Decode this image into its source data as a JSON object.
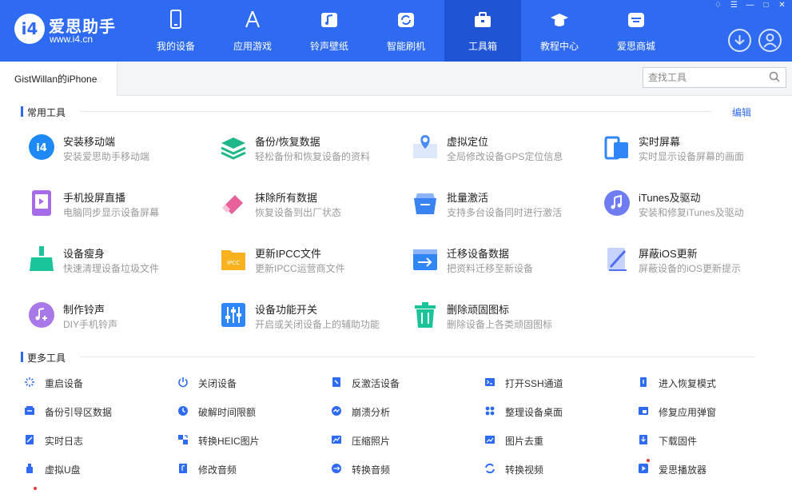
{
  "app": {
    "logo_mark": "i4",
    "logo_name": "爱思助手",
    "logo_url": "www.i4.cn"
  },
  "nav": {
    "items": [
      {
        "label": "我的设备",
        "icon": "phone-icon"
      },
      {
        "label": "应用游戏",
        "icon": "appstore-icon"
      },
      {
        "label": "铃声壁纸",
        "icon": "music-icon"
      },
      {
        "label": "智能刷机",
        "icon": "refresh-icon"
      },
      {
        "label": "工具箱",
        "icon": "toolbox-icon"
      },
      {
        "label": "教程中心",
        "icon": "graduation-cap-icon"
      },
      {
        "label": "爱思商城",
        "icon": "store-icon"
      }
    ],
    "active": "工具箱"
  },
  "device_tab": {
    "label": "GistWillan的iPhone"
  },
  "search": {
    "placeholder": "查找工具"
  },
  "common": {
    "title": "常用工具",
    "edit_label": "编辑",
    "tools": [
      {
        "name": "安装移动端",
        "desc": "安装爱思助手移动端",
        "icon": "i4-app-icon",
        "color": "#1e88f5"
      },
      {
        "name": "备份/恢复数据",
        "desc": "轻松备份和恢复设备的资料",
        "icon": "layers-icon",
        "color": "#1fb88a"
      },
      {
        "name": "虚拟定位",
        "desc": "全局修改设备GPS定位信息",
        "icon": "map-pin-icon",
        "color": "#4a8af4"
      },
      {
        "name": "实时屏幕",
        "desc": "实时显示设备屏幕的画面",
        "icon": "screen-mirror-icon",
        "color": "#2f86f6"
      },
      {
        "name": "手机投屏直播",
        "desc": "电脑同步显示设备屏幕",
        "icon": "cast-live-icon",
        "color": "#a66be8"
      },
      {
        "name": "抹除所有数据",
        "desc": "恢复设备到出厂状态",
        "icon": "eraser-icon",
        "color": "#e8609a"
      },
      {
        "name": "批量激活",
        "desc": "支持多台设备同时进行激活",
        "icon": "batch-activate-icon",
        "color": "#3a82f2"
      },
      {
        "name": "iTunes及驱动",
        "desc": "安装和修复iTunes及驱动",
        "icon": "itunes-icon",
        "color": "#6f7cf2"
      },
      {
        "name": "设备瘦身",
        "desc": "快速清理设备垃圾文件",
        "icon": "broom-icon",
        "color": "#19c49a"
      },
      {
        "name": "更新IPCC文件",
        "desc": "更新IPCC运营商文件",
        "icon": "ipcc-folder-icon",
        "color": "#f7b21d"
      },
      {
        "name": "迁移设备数据",
        "desc": "把资料迁移至新设备",
        "icon": "migrate-icon",
        "color": "#2f86f6"
      },
      {
        "name": "屏蔽iOS更新",
        "desc": "屏蔽设备的iOS更新提示",
        "icon": "block-update-icon",
        "color": "#4f6ff0"
      },
      {
        "name": "制作铃声",
        "desc": "DIY手机铃声",
        "icon": "ringtone-icon",
        "color": "#a877e8"
      },
      {
        "name": "设备功能开关",
        "desc": "开启或关闭设备上的辅助功能",
        "icon": "toggle-sliders-icon",
        "color": "#2f86f6"
      },
      {
        "name": "删除顽固图标",
        "desc": "删除设备上各类顽固图标",
        "icon": "trash-icon",
        "color": "#19c49a"
      }
    ]
  },
  "more": {
    "title": "更多工具",
    "tools": [
      {
        "name": "重启设备",
        "icon": "restart-icon"
      },
      {
        "name": "关闭设备",
        "icon": "power-icon"
      },
      {
        "name": "反激活设备",
        "icon": "deactivate-icon"
      },
      {
        "name": "打开SSH通道",
        "icon": "terminal-icon"
      },
      {
        "name": "进入恢复模式",
        "icon": "recovery-icon"
      },
      {
        "name": "备份引导区数据",
        "icon": "backup-boot-icon"
      },
      {
        "name": "破解时间限额",
        "icon": "clock-icon"
      },
      {
        "name": "崩溃分析",
        "icon": "crash-analysis-icon"
      },
      {
        "name": "整理设备桌面",
        "icon": "grid-icon"
      },
      {
        "name": "修复应用弹窗",
        "icon": "repair-popup-icon"
      },
      {
        "name": "实时日志",
        "icon": "log-icon"
      },
      {
        "name": "转换HEIC图片",
        "icon": "convert-heic-icon"
      },
      {
        "name": "压缩照片",
        "icon": "compress-photo-icon"
      },
      {
        "name": "图片去重",
        "icon": "dedupe-image-icon"
      },
      {
        "name": "下载固件",
        "icon": "download-firmware-icon"
      },
      {
        "name": "虚拟U盘",
        "icon": "usb-drive-icon"
      },
      {
        "name": "修改音频",
        "icon": "edit-audio-icon"
      },
      {
        "name": "转换音频",
        "icon": "convert-audio-icon"
      },
      {
        "name": "转换视频",
        "icon": "convert-video-icon"
      },
      {
        "name": "爱思播放器",
        "icon": "player-icon"
      }
    ]
  }
}
